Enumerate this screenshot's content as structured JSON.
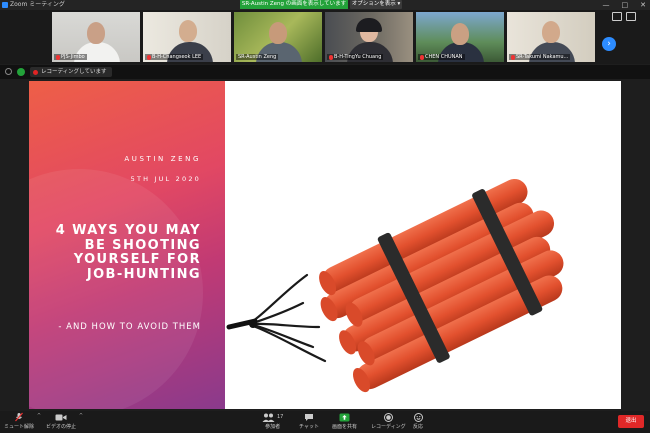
{
  "window": {
    "app_title": "Zoom ミーティング",
    "controls": [
      "—",
      "□",
      "✕"
    ]
  },
  "share_banner": {
    "text": "SR-Austin Zeng の画面を表示しています",
    "options_label": "オプションを表示",
    "options_caret": "▾"
  },
  "participants": [
    {
      "name": "PJS-Jimbo"
    },
    {
      "name": "B-H-Changseok LEE"
    },
    {
      "name": "SR-Austin Zeng"
    },
    {
      "name": "B-H-TingYu Chuang"
    },
    {
      "name": "CHEN CHUNAN"
    },
    {
      "name": "SR-Takumi Nakamu..."
    }
  ],
  "strip_nav": {
    "next_arrow": "›"
  },
  "recording": {
    "label": "レコーディングしています"
  },
  "slide": {
    "author": "AUSTIN ZENG",
    "date": "5TH JUL 2020",
    "title": "4 WAYS YOU MAY BE SHOOTING YOURSELF FOR JOB-HUNTING",
    "subtitle": "- AND HOW TO AVOID THEM"
  },
  "toolbar": {
    "mute": "ミュート解除",
    "video": "ビデオの停止",
    "participants": "参加者",
    "participant_count": "17",
    "chat": "チャット",
    "share": "画面を共有",
    "record": "レコーディング",
    "reactions": "反応",
    "end": "退出"
  },
  "colors": {
    "share_green": "#23a23a",
    "accent_blue": "#2d8cff",
    "end_red": "#e02828",
    "slide_gradient_top": "#ee5f47",
    "slide_gradient_bottom": "#8a3a8c"
  }
}
